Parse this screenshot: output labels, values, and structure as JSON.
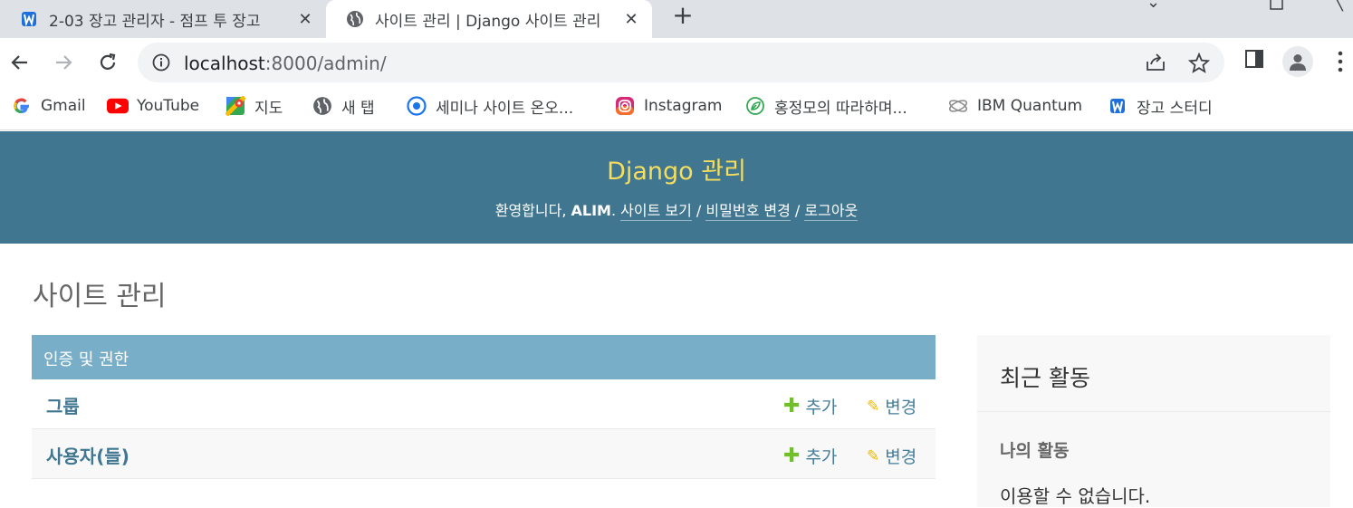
{
  "browser": {
    "tabs": [
      {
        "title": "2-03 장고 관리자 - 점프 투 장고",
        "icon": "wikidocs-icon",
        "active": false
      },
      {
        "title": "사이트 관리 | Django 사이트 관리",
        "icon": "globe-icon",
        "active": true
      }
    ],
    "url_host": "localhost",
    "url_rest": ":8000/admin/",
    "bookmarks": [
      {
        "label": "Gmail",
        "icon": "google-icon"
      },
      {
        "label": "YouTube",
        "icon": "youtube-icon"
      },
      {
        "label": "지도",
        "icon": "maps-icon"
      },
      {
        "label": "새 탭",
        "icon": "globe-icon"
      },
      {
        "label": "세미나 사이트 온오...",
        "icon": "target-icon"
      },
      {
        "label": "Instagram",
        "icon": "instagram-icon"
      },
      {
        "label": "홍정모의 따라하며...",
        "icon": "leaf-icon"
      },
      {
        "label": "IBM Quantum",
        "icon": "quantum-icon"
      },
      {
        "label": "장고 스터디",
        "icon": "wikidocs-icon"
      }
    ]
  },
  "header": {
    "branding": "Django 관리",
    "welcome": "환영합니다,",
    "username": "ALIM",
    "period": ".",
    "view_site": "사이트 보기",
    "sep": "/",
    "change_password": "비밀번호 변경",
    "logout": "로그아웃"
  },
  "main": {
    "title": "사이트 관리",
    "app": {
      "caption": "인증 및 권한",
      "models": [
        {
          "name": "그룹",
          "add": "추가",
          "change": "변경"
        },
        {
          "name": "사용자(들)",
          "add": "추가",
          "change": "변경"
        }
      ]
    }
  },
  "sidebar": {
    "title": "최근 활동",
    "subtitle": "나의 활동",
    "empty": "이용할 수 없습니다."
  },
  "colors": {
    "header_bg": "#417690",
    "branding": "#f5dd5d",
    "caption_bg": "#79aec8",
    "link": "#447e9b",
    "add": "#70bf2b",
    "change": "#efb80b"
  }
}
